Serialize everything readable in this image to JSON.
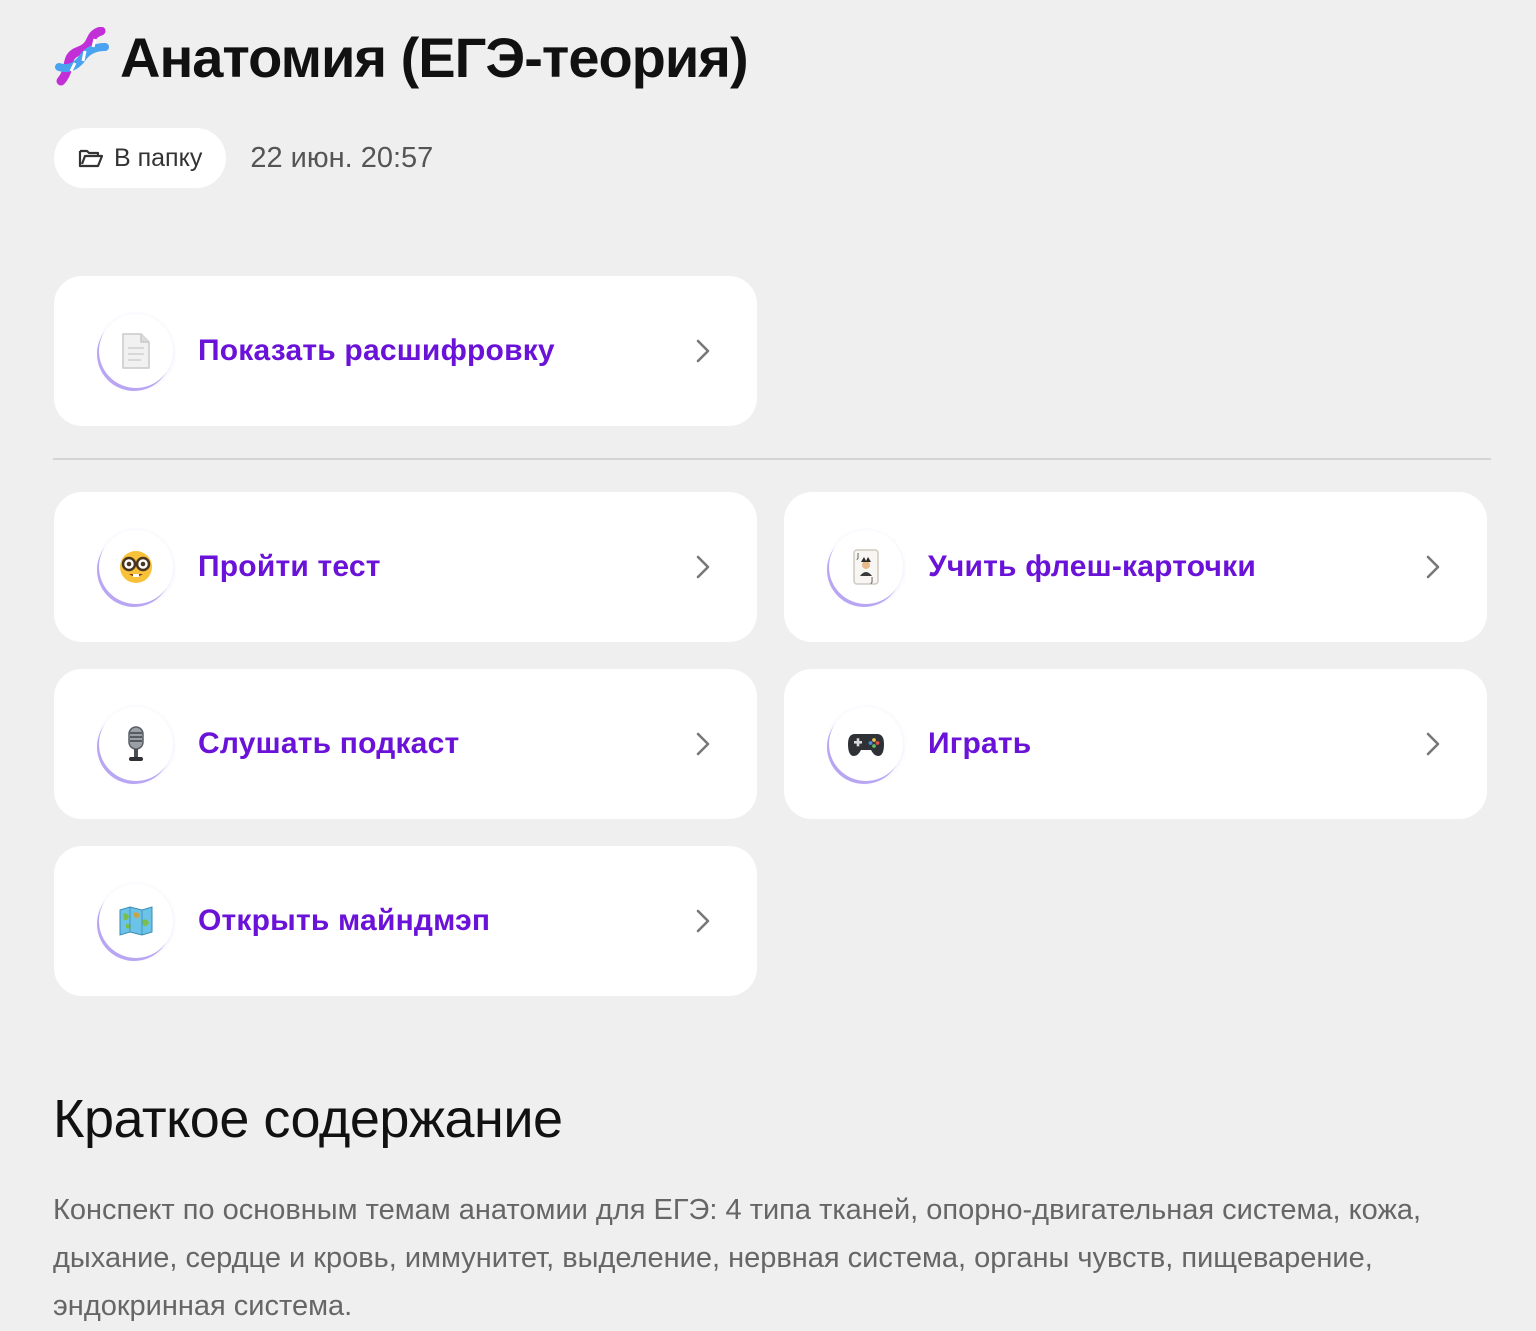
{
  "header": {
    "title": "Анатомия (ЕГЭ-теория)",
    "title_icon": "dna-icon"
  },
  "meta": {
    "folder_button_label": "В папку",
    "folder_icon": "folder-icon",
    "date": "22 июн. 20:57"
  },
  "actions": {
    "transcript": {
      "label": "Показать расшифровку",
      "icon": "document-icon"
    },
    "test": {
      "label": "Пройти тест",
      "icon": "nerd-face-icon"
    },
    "flashcards": {
      "label": "Учить флеш-карточки",
      "icon": "playing-card-icon"
    },
    "podcast": {
      "label": "Слушать подкаст",
      "icon": "microphone-icon"
    },
    "game": {
      "label": "Играть",
      "icon": "gamepad-icon"
    },
    "mindmap": {
      "label": "Открыть майндмэп",
      "icon": "map-icon"
    }
  },
  "summary": {
    "heading": "Краткое содержание",
    "text": "Конспект по основным темам анатомии для ЕГЭ: 4 типа тканей, опорно-двигательная система, кожа, дыхание, сердце и кровь, иммунитет, выделение, нервная система, органы чувств, пищеварение, эндокринная система."
  },
  "colors": {
    "background": "#efefef",
    "card": "#ffffff",
    "accent": "#6a12d8",
    "icon_ring": "#b9a6f3"
  }
}
